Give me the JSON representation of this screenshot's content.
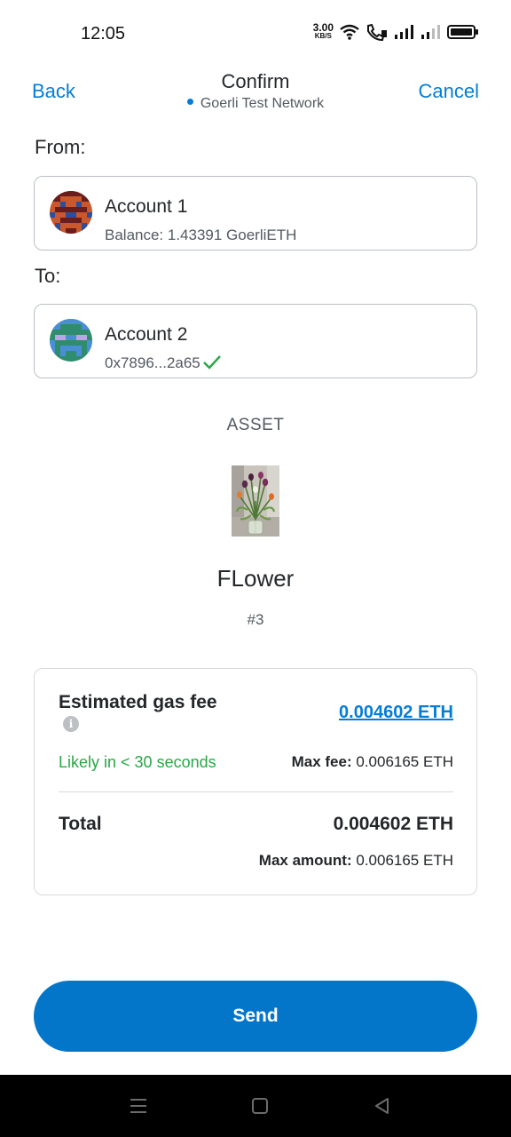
{
  "status_bar": {
    "time": "12:05",
    "net_speed_value": "3.00",
    "net_speed_unit": "KB/S",
    "icons": [
      "wifi-icon",
      "volte-call-icon",
      "signal-icon",
      "signal-icon",
      "battery-icon"
    ]
  },
  "header": {
    "back_label": "Back",
    "title": "Confirm",
    "network": "Goerli Test Network",
    "cancel_label": "Cancel"
  },
  "from": {
    "label": "From:",
    "account_name": "Account 1",
    "balance": "Balance: 1.43391 GoerliETH"
  },
  "to": {
    "label": "To:",
    "account_name": "Account 2",
    "address": "0x7896...2a65"
  },
  "asset": {
    "label": "ASSET",
    "name": "FLower",
    "token_id": "#3"
  },
  "gas": {
    "title": "Estimated gas fee",
    "value": "0.004602 ETH",
    "likely": "Likely in < 30 seconds",
    "max_fee_label": "Max fee:",
    "max_fee_value": "0.006165 ETH",
    "total_label": "Total",
    "total_value": "0.004602 ETH",
    "max_amount_label": "Max amount:",
    "max_amount_value": "0.006165 ETH"
  },
  "send_label": "Send",
  "colors": {
    "accent": "#037dd6",
    "send_button": "#0376c9",
    "success": "#28a745"
  }
}
